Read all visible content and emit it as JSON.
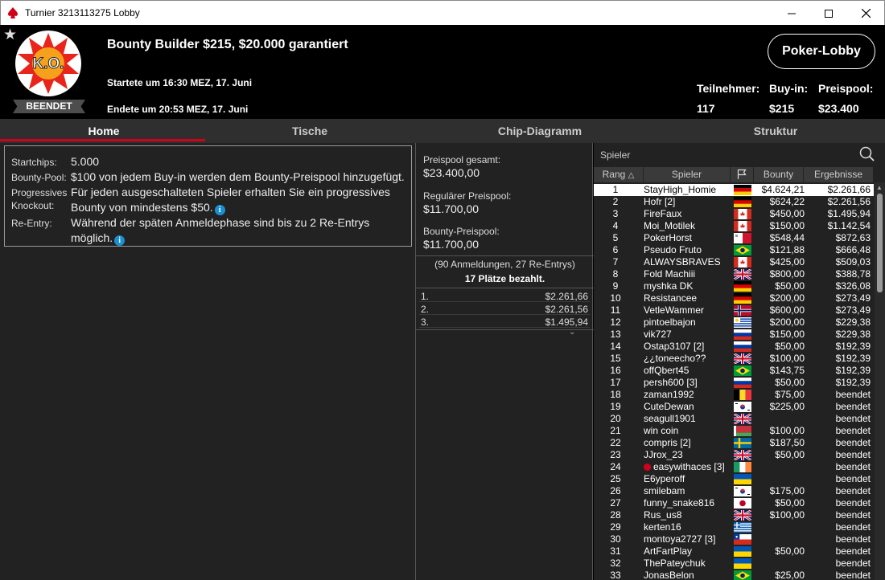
{
  "window": {
    "title": "Turnier 3213113275 Lobby"
  },
  "header": {
    "tournament_name": "Bounty Builder $215, $20.000 garantiert",
    "start_text": "Startete um 16:30 MEZ, 17. Juni",
    "end_text": "Endete um 20:53 MEZ, 17. Juni",
    "status": "BEENDET",
    "logo_text": "K.O.",
    "lobby_button": "Poker-Lobby",
    "stats": [
      {
        "label": "Teilnehmer:",
        "value": "117"
      },
      {
        "label": "Buy-in:",
        "value": "$215"
      },
      {
        "label": "Preispool:",
        "value": "$23.400"
      }
    ]
  },
  "tabs": [
    "Home",
    "Tische",
    "Chip-Diagramm",
    "Struktur"
  ],
  "active_tab": "Home",
  "info": {
    "startchips_label": "Startchips:",
    "startchips_value": "5.000",
    "bountypool_label": "Bounty-Pool:",
    "bountypool_value": "$100 von jedem Buy-in werden dem Bounty-Preispool hinzugefügt.",
    "pko_label_1": "Progressives",
    "pko_label_2": "Knockout:",
    "pko_value_1": "Für jeden ausgeschalteten Spieler erhalten Sie ein progressives",
    "pko_value_2": "Bounty von mindestens $50.",
    "reentry_label": "Re-Entry:",
    "reentry_value_1": "Während der späten Anmeldephase sind bis zu 2 Re-Entrys",
    "reentry_value_2": "möglich."
  },
  "prizepool": {
    "total_label": "Preispool gesamt:",
    "total_value": "$23.400,00",
    "regular_label": "Regulärer Preispool:",
    "regular_value": "$11.700,00",
    "bounty_label": "Bounty-Preispool:",
    "bounty_value": "$11.700,00",
    "entries_text": "(90 Anmeldungen, 27 Re-Entrys)",
    "paid_text": "17 Plätze bezahlt.",
    "payouts": [
      {
        "place": "1.",
        "amount": "$2.261,66"
      },
      {
        "place": "2.",
        "amount": "$2.261,56"
      },
      {
        "place": "3.",
        "amount": "$1.495,94"
      }
    ]
  },
  "players_panel": {
    "search_placeholder": "Spieler",
    "columns": {
      "rank": "Rang",
      "player": "Spieler",
      "bounty": "Bounty",
      "result": "Ergebnisse"
    },
    "rows": [
      {
        "rank": "1",
        "name": "StayHigh_Homie",
        "flag": "de",
        "bounty": "$4.624,21",
        "result": "$2.261,66",
        "selected": true
      },
      {
        "rank": "2",
        "name": "Hofr [2]",
        "flag": "de",
        "bounty": "$624,22",
        "result": "$2.261,56"
      },
      {
        "rank": "3",
        "name": "FireFaux",
        "flag": "ca",
        "bounty": "$450,00",
        "result": "$1.495,94"
      },
      {
        "rank": "4",
        "name": "Moi_Motilek",
        "flag": "ca",
        "bounty": "$150,00",
        "result": "$1.142,54"
      },
      {
        "rank": "5",
        "name": "PokerHorst",
        "flag": "mt",
        "bounty": "$548,44",
        "result": "$872,63"
      },
      {
        "rank": "6",
        "name": "Pseudo Fruto",
        "flag": "br",
        "bounty": "$121,88",
        "result": "$666,48"
      },
      {
        "rank": "7",
        "name": "ALWAYSBRAVES",
        "flag": "ca",
        "bounty": "$425,00",
        "result": "$509,03"
      },
      {
        "rank": "8",
        "name": "Fold Machiii",
        "flag": "gb",
        "bounty": "$800,00",
        "result": "$388,78"
      },
      {
        "rank": "9",
        "name": "myshka DK",
        "flag": "de",
        "bounty": "$50,00",
        "result": "$326,08"
      },
      {
        "rank": "10",
        "name": "Resistancee",
        "flag": "de",
        "bounty": "$200,00",
        "result": "$273,49"
      },
      {
        "rank": "11",
        "name": "VetleWammer",
        "flag": "no",
        "bounty": "$600,00",
        "result": "$273,49"
      },
      {
        "rank": "12",
        "name": "pintoelbajon",
        "flag": "uy",
        "bounty": "$200,00",
        "result": "$229,38"
      },
      {
        "rank": "13",
        "name": "vik727",
        "flag": "ru",
        "bounty": "$150,00",
        "result": "$229,38"
      },
      {
        "rank": "14",
        "name": "Ostap3107 [2]",
        "flag": "ru",
        "bounty": "$50,00",
        "result": "$192,39"
      },
      {
        "rank": "15",
        "name": "¿¿toneecho??",
        "flag": "gb",
        "bounty": "$100,00",
        "result": "$192,39"
      },
      {
        "rank": "16",
        "name": "offQbert45",
        "flag": "br",
        "bounty": "$143,75",
        "result": "$192,39"
      },
      {
        "rank": "17",
        "name": "persh600 [3]",
        "flag": "ru",
        "bounty": "$50,00",
        "result": "$192,39"
      },
      {
        "rank": "18",
        "name": "zaman1992",
        "flag": "be",
        "bounty": "$75,00",
        "result": "beendet"
      },
      {
        "rank": "19",
        "name": "CuteDewan",
        "flag": "kr",
        "bounty": "$225,00",
        "result": "beendet"
      },
      {
        "rank": "20",
        "name": "seagull1901",
        "flag": "gb",
        "bounty": "",
        "result": "beendet"
      },
      {
        "rank": "21",
        "name": "win coin",
        "flag": "by",
        "bounty": "$100,00",
        "result": "beendet"
      },
      {
        "rank": "22",
        "name": "compris [2]",
        "flag": "se",
        "bounty": "$187,50",
        "result": "beendet"
      },
      {
        "rank": "23",
        "name": "JJrox_23",
        "flag": "gb",
        "bounty": "$50,00",
        "result": "beendet"
      },
      {
        "rank": "24",
        "name": "easywithaces [3]",
        "flag": "ie",
        "bounty": "",
        "result": "beendet",
        "star": true
      },
      {
        "rank": "25",
        "name": "E6yperoff",
        "flag": "ua",
        "bounty": "",
        "result": "beendet"
      },
      {
        "rank": "26",
        "name": "smilebam",
        "flag": "kr",
        "bounty": "$175,00",
        "result": "beendet"
      },
      {
        "rank": "27",
        "name": "funny_snake816",
        "flag": "jp",
        "bounty": "$50,00",
        "result": "beendet"
      },
      {
        "rank": "28",
        "name": "Rus_us8",
        "flag": "gb",
        "bounty": "$100,00",
        "result": "beendet"
      },
      {
        "rank": "29",
        "name": "kerten16",
        "flag": "gr",
        "bounty": "",
        "result": "beendet"
      },
      {
        "rank": "30",
        "name": "montoya2727 [3]",
        "flag": "cl",
        "bounty": "",
        "result": "beendet"
      },
      {
        "rank": "31",
        "name": "ArtFartPlay",
        "flag": "ua",
        "bounty": "$50,00",
        "result": "beendet"
      },
      {
        "rank": "32",
        "name": "ThePateychuk",
        "flag": "ua",
        "bounty": "",
        "result": "beendet"
      },
      {
        "rank": "33",
        "name": "JonasBelon",
        "flag": "br",
        "bounty": "$25,00",
        "result": "beendet"
      }
    ]
  },
  "colors": {
    "accent_red": "#d0021b",
    "background": "#000000",
    "panel": "#222222",
    "info_icon": "#1a8fd1"
  }
}
